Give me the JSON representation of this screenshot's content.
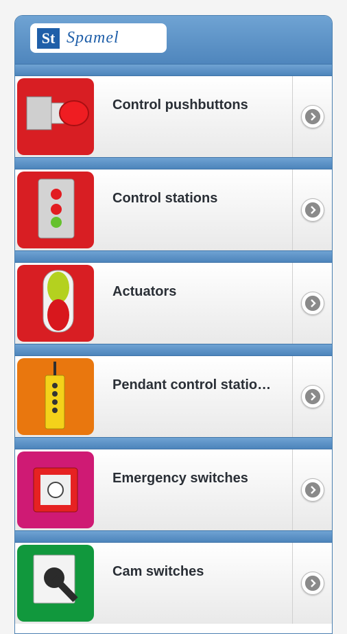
{
  "brand": {
    "logo_mark": "St",
    "logo_text": "Spamel"
  },
  "items": [
    {
      "label": "Control pushbuttons",
      "bg": "#d81e23"
    },
    {
      "label": "Control stations",
      "bg": "#d81e23"
    },
    {
      "label": "Actuators",
      "bg": "#d81e23"
    },
    {
      "label": "Pendant control statio…",
      "bg": "#e9770e"
    },
    {
      "label": "Emergency switches",
      "bg": "#cf1a74"
    },
    {
      "label": "Cam switches",
      "bg": "#11983d"
    }
  ]
}
